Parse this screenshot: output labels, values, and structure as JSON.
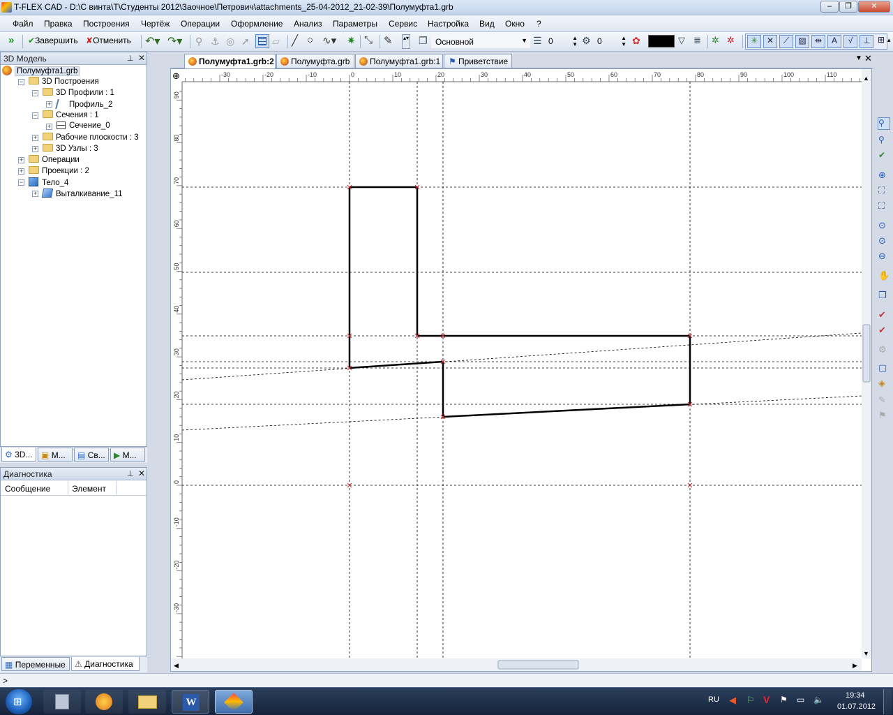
{
  "window": {
    "title": "T-FLEX CAD - D:\\С винта\\Т\\Студенты 2012\\Заочное\\Петрович\\attachments_25-04-2012_21-02-39\\Полумуфта1.grb"
  },
  "menu": [
    "Файл",
    "Правка",
    "Построения",
    "Чертёж",
    "Операции",
    "Оформление",
    "Анализ",
    "Параметры",
    "Сервис",
    "Настройка",
    "Вид",
    "Окно",
    "?"
  ],
  "toolbar": {
    "finish_label": "Завершить",
    "cancel_label": "Отменить",
    "layer_name": "Основной",
    "layer_value": "0",
    "level_value": "0",
    "color": "#000000"
  },
  "model_panel": {
    "title": "3D Модель",
    "tree": [
      {
        "label": "Полумуфта1.grb",
        "indent": 0,
        "icon": "document-icon",
        "expander": ""
      },
      {
        "label": "3D Построения",
        "indent": 1,
        "icon": "folder-icon",
        "expander": "-"
      },
      {
        "label": "3D Профили : 1",
        "indent": 2,
        "icon": "folder-icon",
        "expander": "-"
      },
      {
        "label": "Профиль_2",
        "indent": 3,
        "icon": "profile-icon",
        "expander": "+"
      },
      {
        "label": "Сечения : 1",
        "indent": 2,
        "icon": "folder-icon",
        "expander": "-"
      },
      {
        "label": "Сечение_0",
        "indent": 3,
        "icon": "section-icon",
        "expander": "+"
      },
      {
        "label": "Рабочие плоскости : 3",
        "indent": 2,
        "icon": "folder-icon",
        "expander": "+"
      },
      {
        "label": "3D Узлы : 3",
        "indent": 2,
        "icon": "folder-icon",
        "expander": "+"
      },
      {
        "label": "Операции",
        "indent": 1,
        "icon": "folder-icon",
        "expander": "+"
      },
      {
        "label": "Проекции : 2",
        "indent": 1,
        "icon": "folder-icon",
        "expander": "+"
      },
      {
        "label": "Тело_4",
        "indent": 1,
        "icon": "body-icon",
        "expander": "-"
      },
      {
        "label": "Выталкивание_11",
        "indent": 2,
        "icon": "extrude-icon",
        "expander": "+"
      }
    ],
    "tabs": [
      "3D...",
      "М...",
      "Св...",
      "М..."
    ]
  },
  "diag_panel": {
    "title": "Диагностика",
    "col_message": "Сообщение",
    "col_element": "Элемент"
  },
  "bottom_tabs": [
    "Переменные",
    "Диагностика"
  ],
  "doc_tabs": [
    "Полумуфта1.grb:2",
    "Полумуфта.grb",
    "Полумуфта1.grb:1",
    "Приветствие"
  ],
  "ruler": {
    "h_labels": [
      "-30",
      "-20",
      "-10",
      "0",
      "10",
      "20",
      "30",
      "40",
      "50",
      "60",
      "70",
      "80",
      "90",
      "100",
      "110"
    ],
    "v_labels": [
      "90",
      "80",
      "70",
      "60",
      "50",
      "40",
      "30",
      "20",
      "10",
      "0",
      "-10",
      "-20",
      "-30"
    ]
  },
  "statusbar": {
    "prompt": ">"
  },
  "taskbar": {
    "lang": "RU",
    "time": "19:34",
    "date": "01.07.2012"
  }
}
